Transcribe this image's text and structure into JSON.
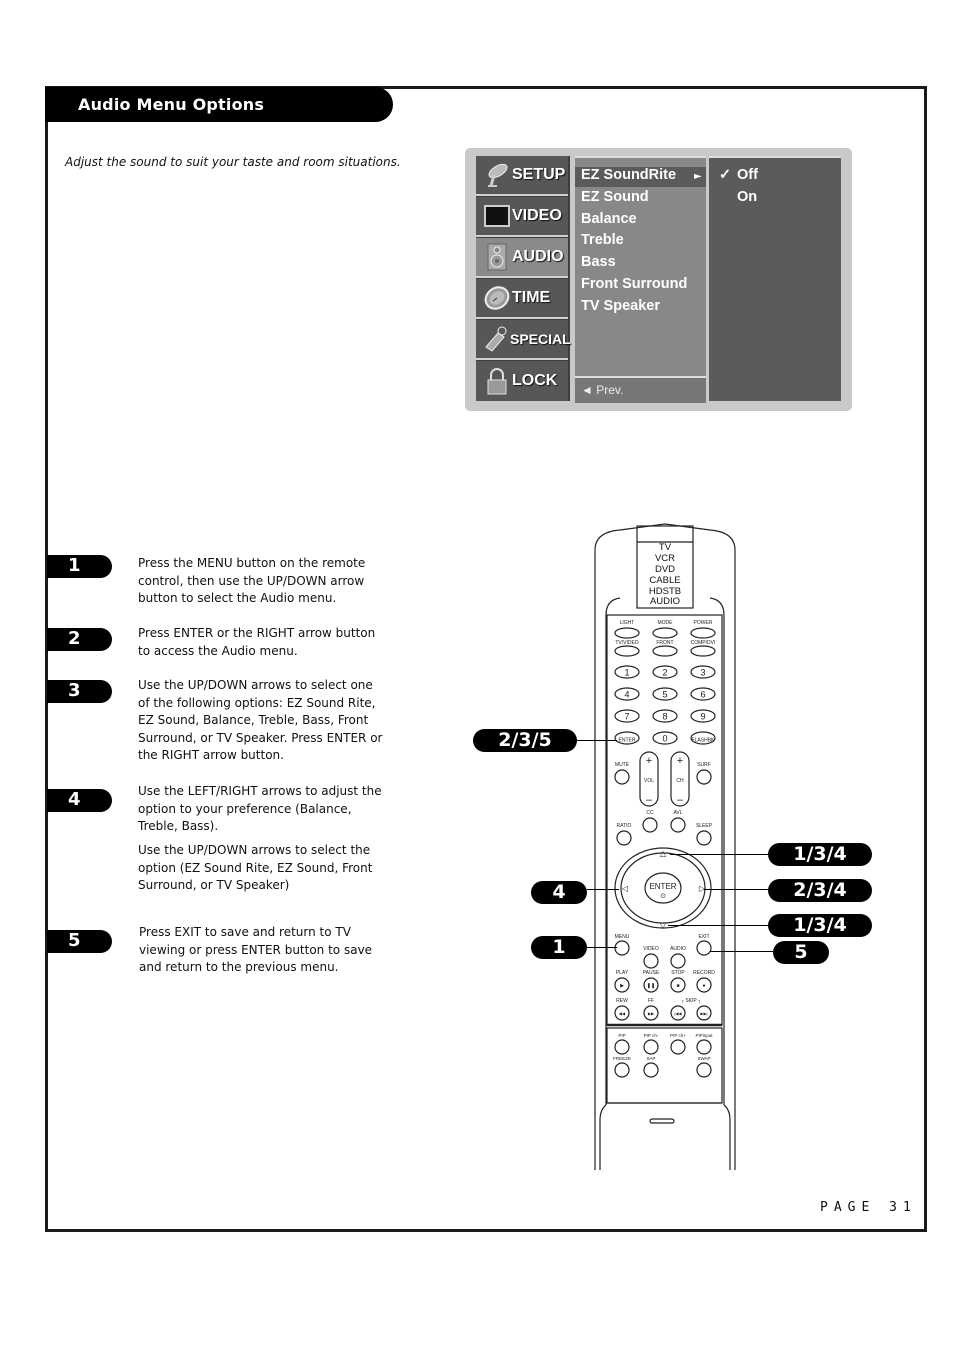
{
  "header": {
    "title": "Audio Menu Options",
    "intro": "Adjust the sound to suit your taste and room situations."
  },
  "osd": {
    "side_menu": [
      {
        "label": "SETUP",
        "icon": "satellite-dish-icon",
        "active": false
      },
      {
        "label": "VIDEO",
        "icon": "screen-icon",
        "active": false
      },
      {
        "label": "AUDIO",
        "icon": "speaker-icon",
        "active": true
      },
      {
        "label": "TIME",
        "icon": "clock-icon",
        "active": false
      },
      {
        "label": "SPECIAL",
        "icon": "tag-icon",
        "active": false
      },
      {
        "label": "LOCK",
        "icon": "padlock-icon",
        "active": false
      }
    ],
    "audio_items": [
      "EZ SoundRite",
      "EZ Sound",
      "Balance",
      "Treble",
      "Bass",
      "Front Surround",
      "TV Speaker"
    ],
    "selected_item": "EZ SoundRite",
    "submenu_arrow": "►",
    "prev_label": "◄ Prev.",
    "options": [
      {
        "label": "Off",
        "checked": true
      },
      {
        "label": "On",
        "checked": false
      }
    ],
    "check_glyph": "✓"
  },
  "steps": [
    {
      "number": "1",
      "text": "Press the MENU button on the remote control, then use the UP/DOWN arrow button to select the Audio menu."
    },
    {
      "number": "2",
      "text": "Press ENTER or the RIGHT arrow button to access the Audio menu."
    },
    {
      "number": "3",
      "text": "Use the UP/DOWN arrows to select one of the following options: EZ Sound Rite, EZ Sound, Balance, Treble, Bass, Front Surround, or TV Speaker. Press ENTER or the RIGHT arrow button."
    },
    {
      "number": "4",
      "text": "Use the LEFT/RIGHT arrows to adjust the option to your preference (Balance, Treble, Bass).",
      "text2": "Use the UP/DOWN arrows to select the option (EZ Sound Rite, EZ Sound, Front Surround, or TV Speaker)"
    },
    {
      "number": "5",
      "text": "Press EXIT to save and return to TV viewing or press ENTER button to save and return to the previous menu."
    }
  ],
  "callouts": {
    "enter_key": "2/3/5",
    "left_arrow": "4",
    "menu": "1",
    "up_arrow": "1/3/4",
    "right_arrow": "2/3/4",
    "down_arrow": "1/3/4",
    "exit": "5"
  },
  "remote": {
    "modes": [
      "TV",
      "VCR",
      "DVD",
      "CABLE",
      "HDSTB",
      "AUDIO"
    ],
    "top_buttons": [
      "LIGHT",
      "MODE",
      "POWER"
    ],
    "second_buttons": [
      "TV/VIDEO",
      "FRONT",
      "COMP/DVI"
    ],
    "number_keys": [
      "1",
      "2",
      "3",
      "4",
      "5",
      "6",
      "7",
      "8",
      "9",
      "ENTER",
      "0",
      "FLASHBK"
    ],
    "mute": "MUTE",
    "vol": "VOL",
    "ch": "CH",
    "surf": "SURF",
    "cc": "CC",
    "avl": "AVL",
    "ratio": "RATIO",
    "sleep": "SLEEP",
    "enter": "ENTER",
    "menu": "MENU",
    "exit": "EXIT",
    "video": "VIDEO",
    "audio": "AUDIO",
    "transport": [
      "PLAY",
      "PAUSE",
      "STOP",
      "RECORD"
    ],
    "transport2": [
      "REW",
      "FF"
    ],
    "skip": "SKIP",
    "pip_row": [
      "PIP",
      "PIP ch-",
      "PIP ch+",
      "PIPinput"
    ],
    "pip_row2": [
      "FREEZE",
      "SAP",
      "SWAP"
    ]
  },
  "footer": {
    "page": "PAGE 31"
  }
}
